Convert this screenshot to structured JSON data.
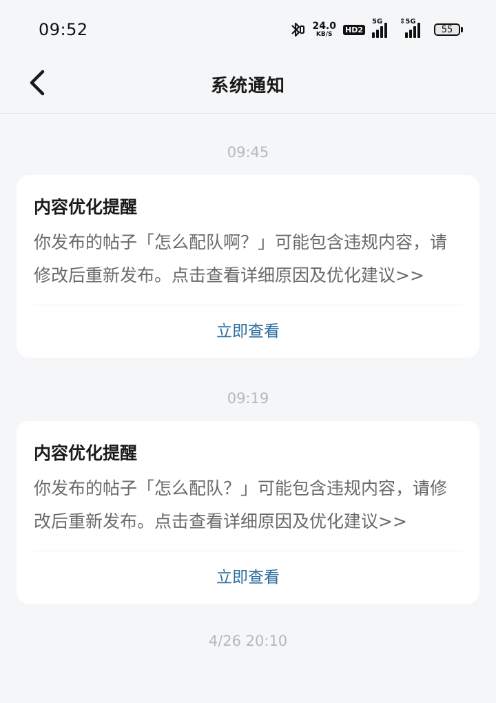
{
  "status_bar": {
    "time": "09:52",
    "net_speed_value": "24.0",
    "net_speed_unit": "KB/S",
    "hd_badge": "HD2",
    "signal1_label": "5G",
    "signal2_label": "⇕5G",
    "battery": "55",
    "icons": [
      "bluetooth-icon",
      "signal-icon",
      "battery-icon"
    ]
  },
  "header": {
    "title": "系统通知",
    "back_icon": "chevron-left-icon"
  },
  "notifications": [
    {
      "time": "09:45",
      "title": "内容优化提醒",
      "body": "你发布的帖子「怎么配队啊？」可能包含违规内容，请修改后重新发布。点击查看详细原因及优化建议>>",
      "action": "立即查看"
    },
    {
      "time": "09:19",
      "title": "内容优化提醒",
      "body": "你发布的帖子「怎么配队？」可能包含违规内容，请修改后重新发布。点击查看详细原因及优化建议>>",
      "action": "立即查看"
    },
    {
      "time": "4/26 20:10"
    }
  ],
  "colors": {
    "background": "#f5f6f8",
    "card": "#ffffff",
    "action_link": "#2e6e9e",
    "timestamp": "#b4b8be"
  }
}
